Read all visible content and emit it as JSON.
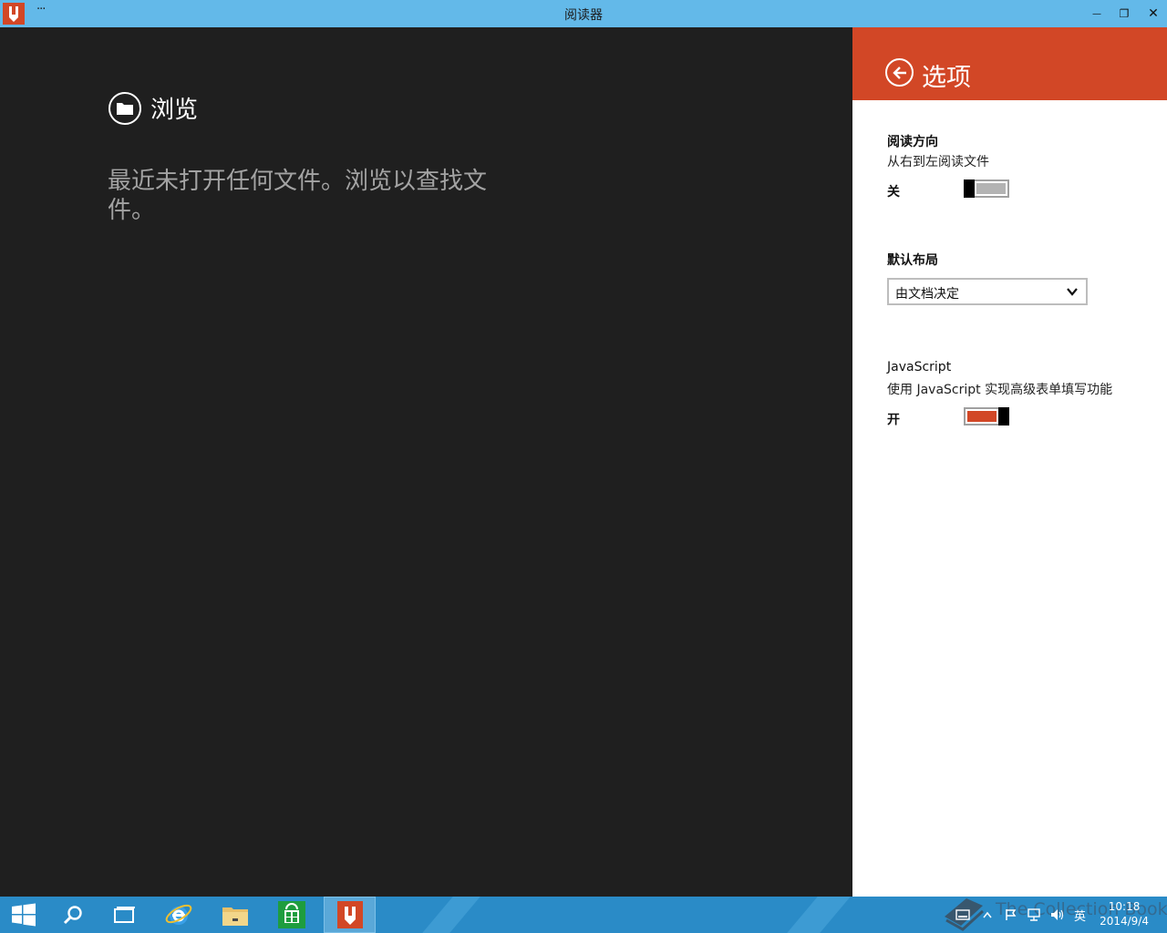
{
  "window": {
    "title": "阅读器",
    "menu_dots": "···",
    "minimize_glyph": "—",
    "restore_glyph": "❐",
    "close_glyph": "✕"
  },
  "main": {
    "browse_label": "浏览",
    "empty_message": "最近未打开任何文件。浏览以查找文件。"
  },
  "settings": {
    "title": "选项",
    "reading_direction": {
      "title": "阅读方向",
      "description": "从右到左阅读文件",
      "state_label": "关",
      "on": false
    },
    "default_layout": {
      "title": "默认布局",
      "selected": "由文档决定"
    },
    "javascript": {
      "title": "JavaScript",
      "description": "使用 JavaScript 实现高级表单填写功能",
      "state_label": "开",
      "on": true
    },
    "accent_color": "#d24726"
  },
  "taskbar": {
    "items": [
      "start-icon",
      "search-icon",
      "task-view-icon",
      "ie-icon",
      "file-explorer-icon",
      "store-icon",
      "reader-icon"
    ],
    "tray": {
      "ime": "英"
    },
    "clock": {
      "time": "10:18",
      "date": "2014/9/4"
    },
    "watermark": "The Collection Book"
  }
}
